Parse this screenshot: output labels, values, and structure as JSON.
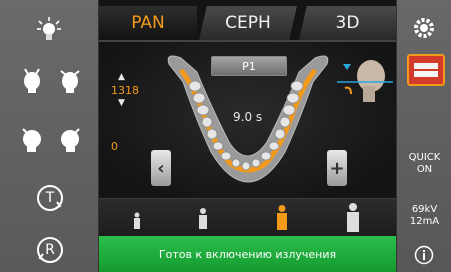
{
  "tabs": [
    {
      "label": "PAN",
      "active": true
    },
    {
      "label": "CEPH",
      "active": false
    },
    {
      "label": "3D",
      "active": false
    }
  ],
  "left_controls": [
    {
      "icon": "light-bulb-icon"
    },
    {
      "icon": "head-tilt-up-icon"
    },
    {
      "icon": "head-tilt-forward-icon"
    },
    {
      "icon": "head-rotate-left-icon"
    },
    {
      "icon": "head-rotate-right-icon"
    },
    {
      "icon": "t-cycle-icon",
      "text": "T"
    },
    {
      "icon": "r-reset-icon",
      "text": "R"
    }
  ],
  "stage": {
    "height_value": "1318",
    "offset_value": "0",
    "program_label": "P1",
    "exposure_time": "9.0 s",
    "left_arrow": "‹",
    "right_arrow": "+"
  },
  "patient_sizes": [
    {
      "icon": "patient-child-icon",
      "selected": false
    },
    {
      "icon": "patient-small-icon",
      "selected": false
    },
    {
      "icon": "patient-medium-icon",
      "selected": true
    },
    {
      "icon": "patient-large-icon",
      "selected": false
    }
  ],
  "status_text": "Готов к включению излучения",
  "right_panel": {
    "quick_line1": "QUICK",
    "quick_line2": "ON",
    "kv": "69kV",
    "ma": "12mA"
  },
  "colors": {
    "accent": "#f39a1a",
    "status_green": "#1fae3c",
    "panel_gray": "#626262"
  }
}
